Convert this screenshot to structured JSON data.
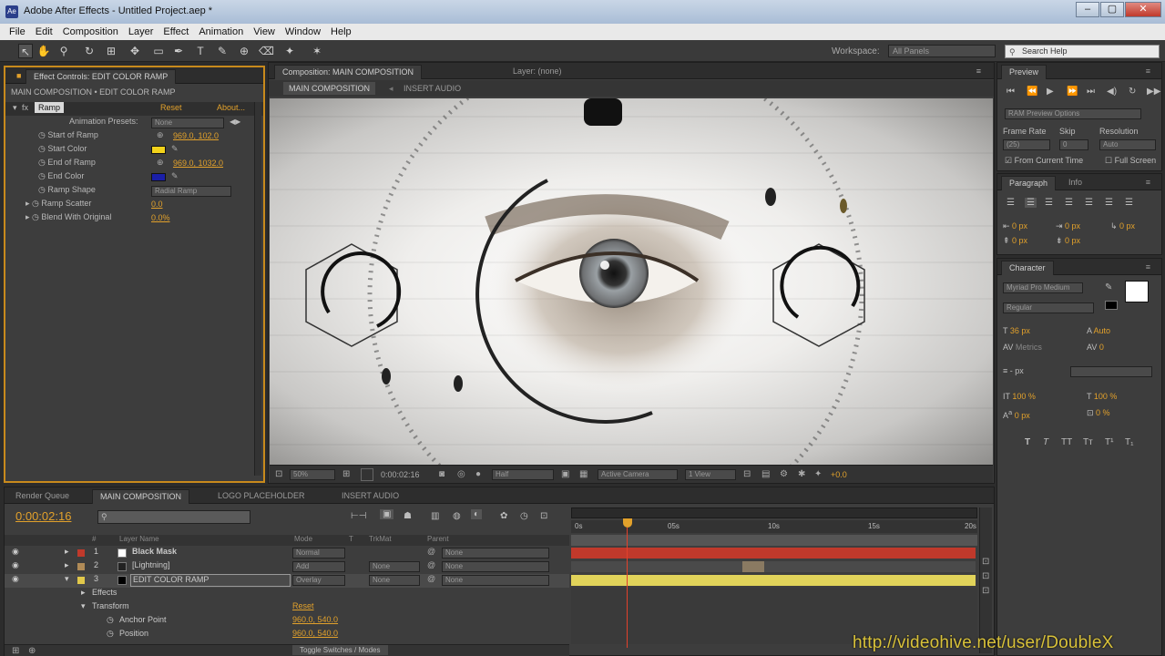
{
  "window": {
    "title": "Adobe After Effects - Untitled Project.aep *",
    "controls": [
      "–",
      "▢",
      "✕"
    ]
  },
  "menu": [
    "File",
    "Edit",
    "Composition",
    "Layer",
    "Effect",
    "Animation",
    "View",
    "Window",
    "Help"
  ],
  "toolbar": {
    "workspace_label": "Workspace:",
    "workspace_value": "All Panels",
    "search_placeholder": "Search Help"
  },
  "effect_controls": {
    "tab": "Effect Controls: EDIT COLOR RAMP",
    "breadcrumb": "MAIN COMPOSITION • EDIT COLOR RAMP",
    "effect_name": "Ramp",
    "effect_reset": "Reset",
    "effect_about": "About...",
    "presets_label": "Animation Presets:",
    "presets_value": "None",
    "properties": [
      {
        "label": "Start of Ramp",
        "value": "969.0, 102.0"
      },
      {
        "label": "Start Color",
        "value": "",
        "color": "#f2d21a"
      },
      {
        "label": "End of Ramp",
        "value": "969.0, 1032.0"
      },
      {
        "label": "End Color",
        "value": "",
        "color": "#1a1fa8"
      },
      {
        "label": "Ramp Shape",
        "value": "Radial Ramp"
      },
      {
        "label": "Ramp Scatter",
        "value": "0.0"
      },
      {
        "label": "Blend With Original",
        "value": "0.0%"
      }
    ]
  },
  "composition": {
    "tab": "Composition: MAIN COMPOSITION",
    "layer_tab": "Layer: (none)",
    "subtabs": [
      "MAIN COMPOSITION",
      "INSERT AUDIO"
    ],
    "footer": {
      "zoom": "50%",
      "timecode": "0:00:02:16",
      "resolution": "Half",
      "camera": "Active Camera",
      "views": "1 View",
      "exposure": "+0.0"
    }
  },
  "preview": {
    "tab": "Preview",
    "options_label": "RAM Preview Options",
    "frame_rate_label": "Frame Rate",
    "skip_label": "Skip",
    "resolution_label": "Resolution",
    "frame_rate_value": "(25)",
    "skip_value": "0",
    "resolution_value": "Auto",
    "from_current_time": "From Current Time",
    "full_screen": "Full Screen"
  },
  "paragraph": {
    "tabs": [
      "Paragraph",
      "Info"
    ],
    "fields": [
      "0 px",
      "0 px",
      "0 px",
      "0 px",
      "0 px"
    ]
  },
  "character": {
    "tab": "Character",
    "font": "Myriad Pro Medium",
    "style": "Regular",
    "size": "36 px",
    "leading": "Auto",
    "kerning": "Metrics",
    "tracking": "0",
    "stroke": "- px",
    "vscale": "100 %",
    "hscale": "100 %",
    "baseline": "0 px",
    "tsume": "0 %"
  },
  "timeline": {
    "tabs": [
      "Render Queue",
      "MAIN COMPOSITION",
      "LOGO PLACEHOLDER",
      "INSERT AUDIO"
    ],
    "timecode": "0:00:02:16",
    "search_placeholder": "",
    "columns": [
      "#",
      "Layer Name",
      "Mode",
      "T",
      "TrkMat",
      "Parent"
    ],
    "layers": [
      {
        "num": "1",
        "name": "Black Mask",
        "mode": "Normal",
        "trkmat": "",
        "parent": "None",
        "color": "#c0392b",
        "swatch": "#ffffff"
      },
      {
        "num": "2",
        "name": "[Lightning]",
        "mode": "Add",
        "trkmat": "None",
        "parent": "None",
        "color": "#b08b57",
        "swatch": "#222222"
      },
      {
        "num": "3",
        "name": "EDIT COLOR RAMP",
        "mode": "Overlay",
        "trkmat": "None",
        "parent": "None",
        "color": "#e1c84a",
        "swatch": "#000000"
      }
    ],
    "sub_rows": [
      {
        "label": "Effects",
        "value": ""
      },
      {
        "label": "Transform",
        "value": "Reset"
      },
      {
        "label": "Anchor Point",
        "value": "960.0, 540.0"
      },
      {
        "label": "Position",
        "value": "960.0, 540.0"
      }
    ],
    "ruler": [
      "0s",
      "05s",
      "10s",
      "15s",
      "20s"
    ],
    "toggle_label": "Toggle Switches / Modes"
  },
  "watermark": "http://videohive.net/user/DoubleX",
  "colors": {
    "accent": "#e2a12b",
    "layer1_bar": "#c0392b",
    "layer3_bar": "#e1d35a",
    "playhead": "#e2a12b"
  }
}
